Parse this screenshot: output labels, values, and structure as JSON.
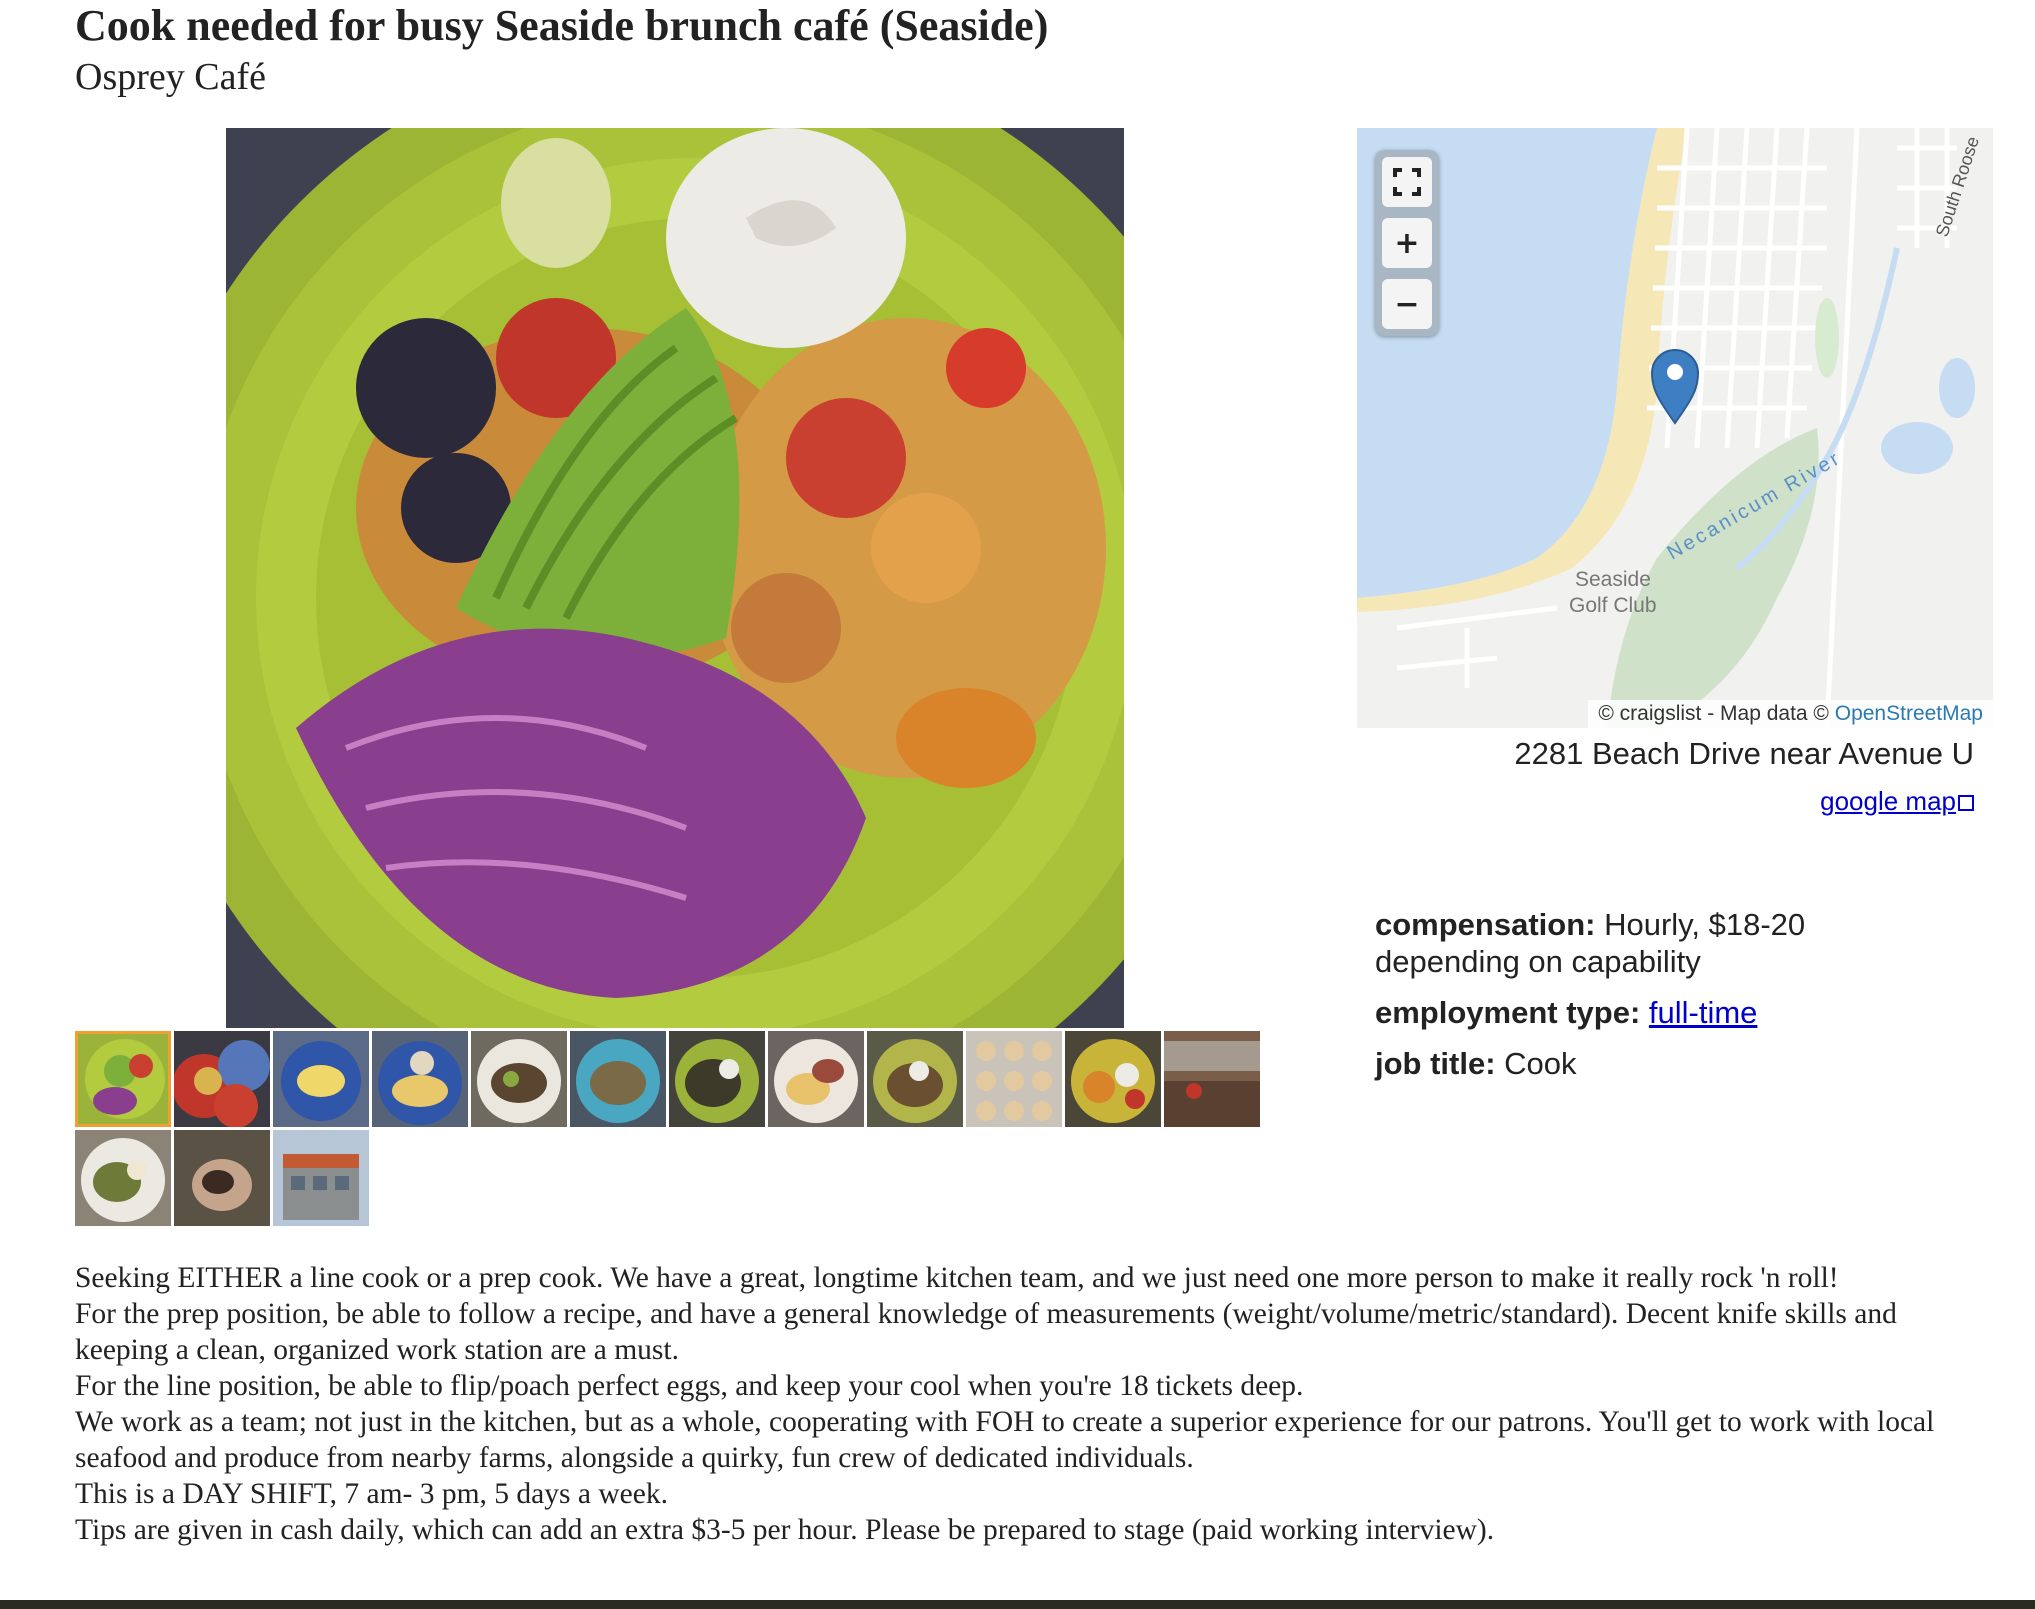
{
  "posting": {
    "title": "Cook needed for busy Seaside brunch café (Seaside)",
    "company": "Osprey Café"
  },
  "gallery": {
    "thumbnail_count": 15,
    "selected_index": 0
  },
  "map": {
    "controls": {
      "fullscreen_icon": "fullscreen-icon",
      "zoom_in": "+",
      "zoom_out": "−"
    },
    "labels": {
      "street": "South Roose",
      "river": "Necanicum River",
      "golf_line1": "Seaside",
      "golf_line2": "Golf Club"
    },
    "attribution_prefix": "© craigslist - Map data © ",
    "attribution_link": "OpenStreetMap",
    "colors": {
      "water": "#c5dcf2",
      "land": "#f2f2f2",
      "beach": "#f6e7b6",
      "park": "#cfe1c8",
      "marker": "#3d7fc2"
    }
  },
  "location": {
    "address": "2281 Beach Drive near Avenue U",
    "google_map_link": "google map"
  },
  "attributes": {
    "compensation_label": "compensation:",
    "compensation_value": "Hourly, $18-20 depending on capability",
    "employment_type_label": "employment type:",
    "employment_type_value": "full-time",
    "job_title_label": "job title:",
    "job_title_value": "Cook"
  },
  "description": [
    "Seeking EITHER a line cook or a prep cook. We have a great, longtime kitchen team, and we just need one more person to make it really rock 'n roll!",
    "For the prep position, be able to follow a recipe, and have a general knowledge of measurements (weight/volume/metric/standard). Decent knife skills and keeping a clean, organized work station are a must.",
    "For the line position, be able to flip/poach perfect eggs, and keep your cool when you're 18 tickets deep.",
    "We work as a team; not just in the kitchen, but as a whole, cooperating with FOH to create a superior experience for our patrons. You'll get to work with local seafood and produce from nearby farms, alongside a quirky, fun crew of dedicated individuals.",
    "This is a DAY SHIFT, 7 am- 3 pm, 5 days a week.",
    "Tips are given in cash daily, which can add an extra $3-5 per hour. Please be prepared to stage (paid working interview)."
  ]
}
